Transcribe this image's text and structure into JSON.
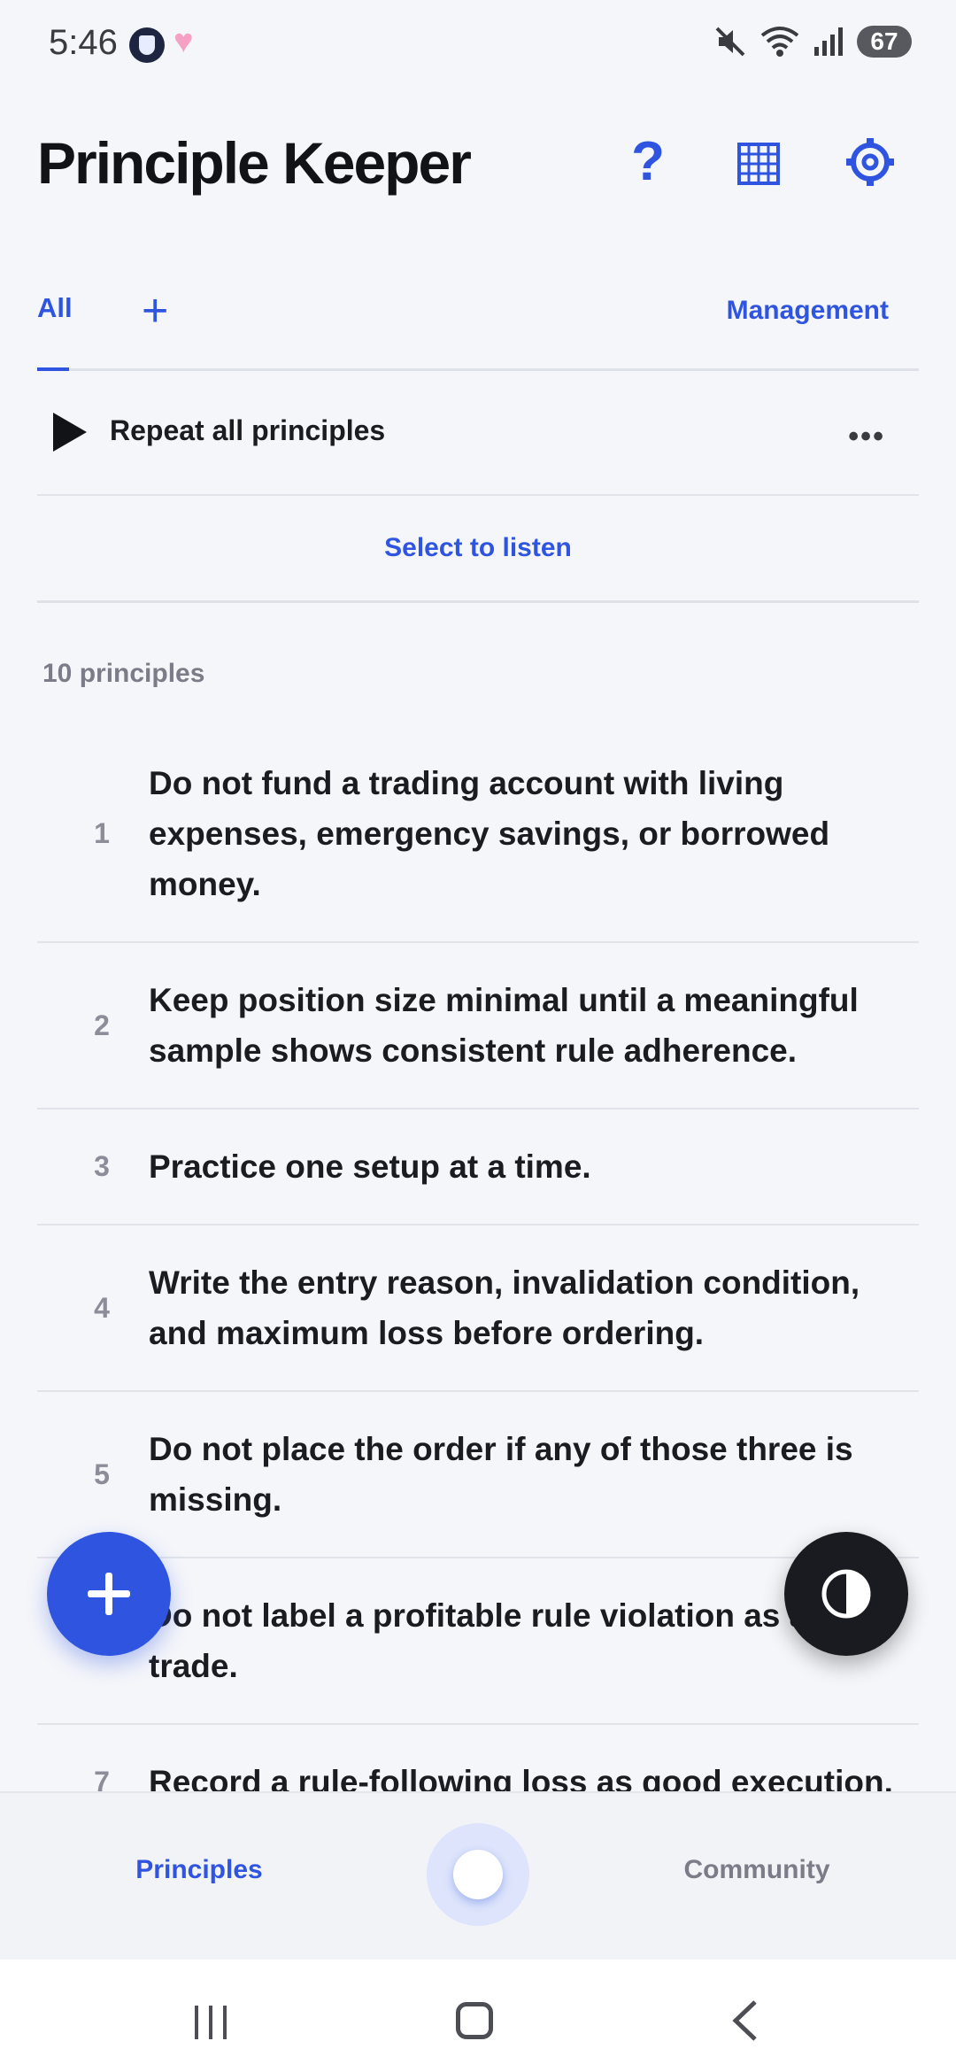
{
  "status_bar": {
    "time": "5:46",
    "battery": "67",
    "icons": [
      "app-shield-icon",
      "heart-icon",
      "mute-icon",
      "wifi-icon",
      "signal-icon",
      "battery-icon"
    ]
  },
  "header": {
    "title": "Principle Keeper",
    "help_icon": "?",
    "icons": [
      "help-icon",
      "grid-icon",
      "gear-icon"
    ]
  },
  "tabs": {
    "all_label": "All",
    "add_label": "+",
    "management_label": "Management"
  },
  "repeat": {
    "label": "Repeat all principles",
    "more": "•••"
  },
  "select_to_listen": "Select to listen",
  "count_label": "10 principles",
  "principles": [
    {
      "num": "1",
      "text": "Do not fund a trading account with living expenses, emergency savings, or borrowed money."
    },
    {
      "num": "2",
      "text": "Keep position size minimal until a meaningful sample shows consistent rule adherence."
    },
    {
      "num": "3",
      "text": "Practice one setup at a time."
    },
    {
      "num": "4",
      "text": "Write the entry reason, invalidation condition, and maximum loss before ordering."
    },
    {
      "num": "5",
      "text": "Do not place the order if any of those three is missing."
    },
    {
      "num": "6",
      "text": "Do not label a profitable rule violation as a good trade."
    },
    {
      "num": "7",
      "text": "Record a rule-following loss as good execution."
    }
  ],
  "bottom_nav": {
    "principles_label": "Principles",
    "community_label": "Community"
  },
  "colors": {
    "accent": "#2f55e0",
    "background": "#f5f6fa",
    "text": "#1b1c22",
    "muted": "#7a7d88"
  }
}
